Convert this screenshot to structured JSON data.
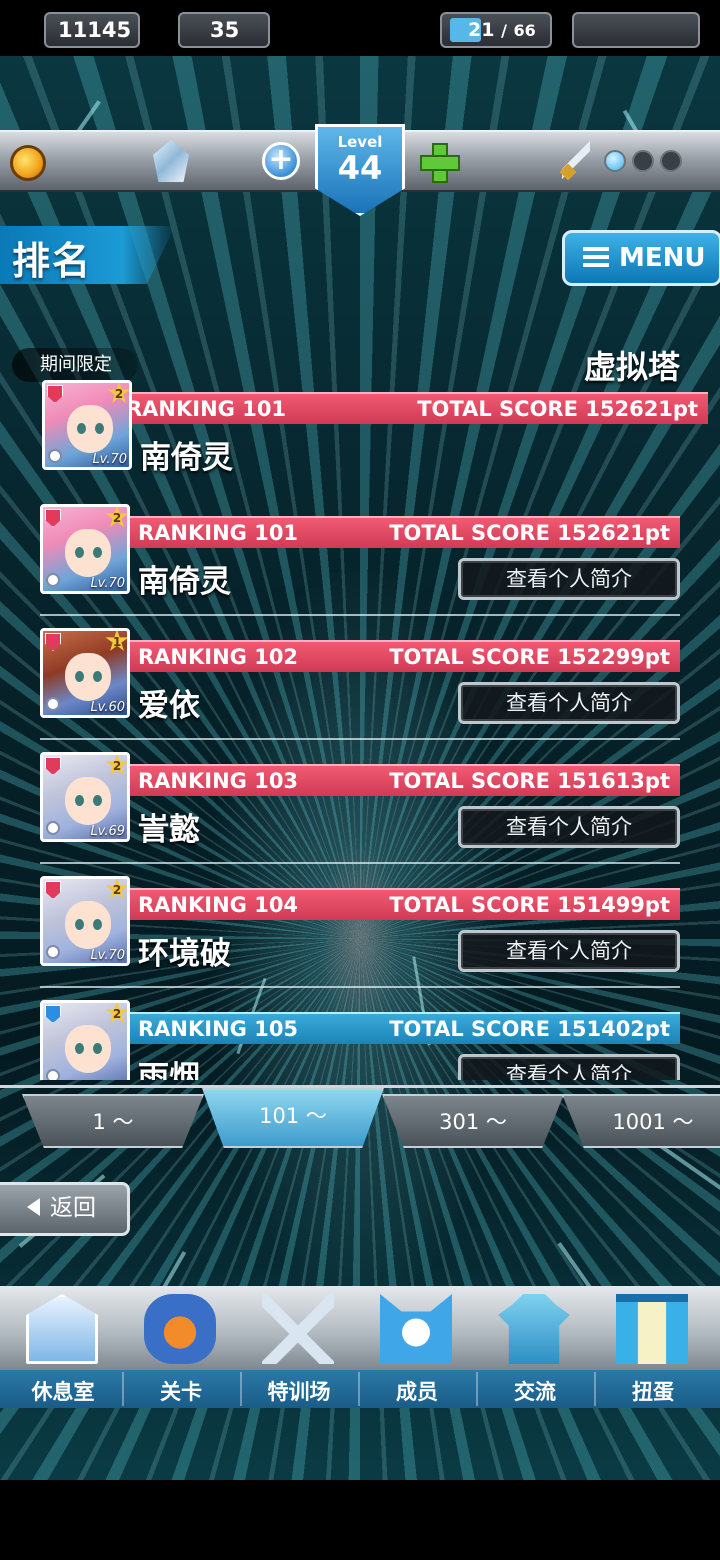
{
  "status": {
    "coins": "11145",
    "gems": "35",
    "level_label": "Level",
    "level_value": "44",
    "stamina_current": "21",
    "stamina_sep": "/",
    "stamina_max": "66",
    "stamina_fill": 0.32,
    "battle_points": 1,
    "battle_points_max": 3
  },
  "header": {
    "title": "排名",
    "menu_label": "MENU"
  },
  "event": {
    "period_tag": "期间限定",
    "name": "虚拟塔"
  },
  "my_rank": {
    "rank": "RANKING 101",
    "score": "TOTAL SCORE 152621pt",
    "name": "南倚灵",
    "level": "Lv.70",
    "stars": "2"
  },
  "ranking_list": [
    {
      "rank": "RANKING 101",
      "score": "TOTAL SCORE 152621pt",
      "name": "南倚灵",
      "level": "Lv.70",
      "stars": "2",
      "profile": "查看个人简介",
      "color": "#e0435f"
    },
    {
      "rank": "RANKING 102",
      "score": "TOTAL SCORE 152299pt",
      "name": "爱依",
      "level": "Lv.60",
      "stars": "1",
      "profile": "查看个人简介",
      "color": "#e0435f"
    },
    {
      "rank": "RANKING 103",
      "score": "TOTAL SCORE 151613pt",
      "name": "訔懿",
      "level": "Lv.69",
      "stars": "2",
      "profile": "查看个人简介",
      "color": "#e0435f"
    },
    {
      "rank": "RANKING 104",
      "score": "TOTAL SCORE 151499pt",
      "name": "环境破",
      "level": "Lv.70",
      "stars": "2",
      "profile": "查看个人简介",
      "color": "#e0435f"
    },
    {
      "rank": "RANKING 105",
      "score": "TOTAL SCORE 151402pt",
      "name": "雨烟",
      "level": "",
      "stars": "2",
      "profile": "查看个人简介",
      "color": "#2496cc"
    }
  ],
  "page_tabs": [
    {
      "label": "1 ～"
    },
    {
      "label": "101 ～"
    },
    {
      "label": "301 ～"
    },
    {
      "label": "1001 ～"
    }
  ],
  "active_page_tab": 1,
  "back_label": "返回",
  "bottom_nav": [
    {
      "label": "休息室",
      "icon": "school-building-icon"
    },
    {
      "label": "关卡",
      "icon": "demon-mask-icon"
    },
    {
      "label": "特训场",
      "icon": "crossed-swords-icon"
    },
    {
      "label": "成员",
      "icon": "cat-mascot-icon"
    },
    {
      "label": "交流",
      "icon": "dress-icon"
    },
    {
      "label": "扭蛋",
      "icon": "curtain-stage-icon"
    }
  ]
}
